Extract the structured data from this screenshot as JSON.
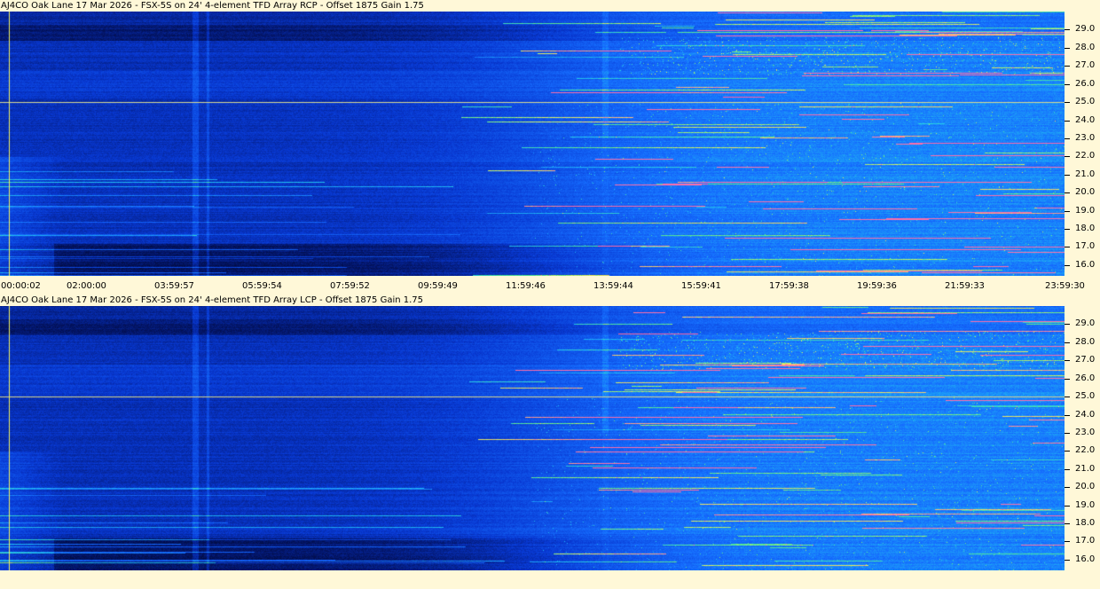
{
  "panels": [
    {
      "id": "rcp",
      "title": "AJ4CO Oak Lane 17 Mar 2026 - FSX-5S on 24' 4-element TFD Array RCP  -  Offset 1875  Gain 1.75",
      "show_time_axis": true
    },
    {
      "id": "lcp",
      "title": "AJ4CO Oak Lane 17 Mar 2026 - FSX-5S on 24' 4-element TFD Array LCP  -  Offset 1875  Gain 1.75",
      "show_time_axis": false
    }
  ],
  "chart_data": {
    "type": "heatmap",
    "x_tick_labels": [
      "00:00:02",
      "02:00:00",
      "03:59:57",
      "05:59:54",
      "07:59:52",
      "09:59:49",
      "11:59:46",
      "13:59:44",
      "15:59:41",
      "17:59:38",
      "19:59:36",
      "21:59:33",
      "23:59:30"
    ],
    "x_range": [
      "00:00:02",
      "23:59:30"
    ],
    "y_tick_labels": [
      "16.0",
      "17.0",
      "18.0",
      "19.0",
      "20.0",
      "21.0",
      "22.0",
      "23.0",
      "24.0",
      "25.0",
      "26.0",
      "27.0",
      "28.0",
      "29.0"
    ],
    "y_range": [
      15.4,
      30.0
    ],
    "y_position": "right",
    "colormap": [
      "#000010",
      "#041a6e",
      "#0a40d8",
      "#1a7cff",
      "#20c8f0",
      "#60f080",
      "#f0f060",
      "#ff70a0"
    ],
    "marker_line_frequency": 25.0,
    "marker_line_color": "#d8d890",
    "time_marker": "00:00:02",
    "time_marker_color": "#f0f060"
  },
  "colors": {
    "background": "#fff8d8",
    "axis_text": "#000000"
  }
}
